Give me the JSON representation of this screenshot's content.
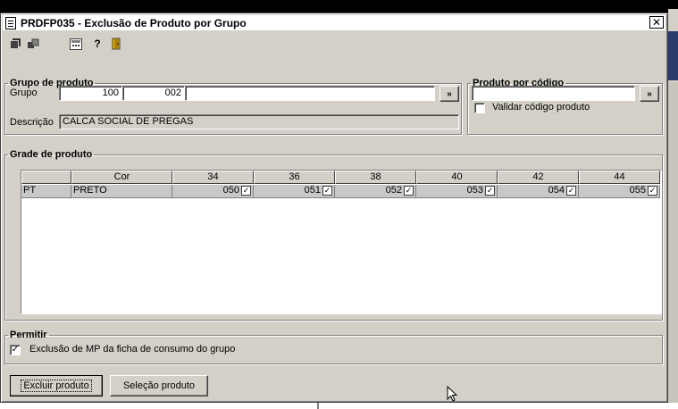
{
  "window": {
    "title": "PRDFP035 - Exclusão de Produto por Grupo",
    "close_symbol": "✕"
  },
  "toolbar": {
    "icons": [
      "arrow-icon",
      "copy-icon",
      "calculator-icon",
      "help-icon",
      "exit-door-icon"
    ],
    "help_symbol": "?"
  },
  "grupo": {
    "legend": "Grupo de produto",
    "grupo_label": "Grupo",
    "grupo_value1": "100",
    "grupo_value2": "002",
    "grupo_value3": "",
    "lookup_label": "»",
    "descricao_label": "Descrição",
    "descricao_value": "CALCA SOCIAL DE PREGAS"
  },
  "produto": {
    "legend": "Produto por código",
    "codigo_value": "",
    "lookup_label": "»",
    "validar_label": "Validar código produto",
    "validar_checked": ""
  },
  "grade": {
    "legend": "Grade de produto",
    "columns": [
      "",
      "Cor",
      "34",
      "36",
      "38",
      "40",
      "42",
      "44"
    ],
    "rows": [
      {
        "code": "PT",
        "color": "PRETO",
        "cells": [
          {
            "value": "050",
            "check": "✓"
          },
          {
            "value": "051",
            "check": "✓"
          },
          {
            "value": "052",
            "check": "✓"
          },
          {
            "value": "053",
            "check": "✓"
          },
          {
            "value": "054",
            "check": "✓"
          },
          {
            "value": "055",
            "check": "✓"
          }
        ]
      }
    ]
  },
  "permitir": {
    "legend": "Permitir",
    "exclusao_label": "Exclusão de MP da ficha de consumo do grupo",
    "exclusao_check": "✓"
  },
  "actions": {
    "excluir_label": "Excluir produto",
    "selecao_label": "Seleção produto"
  }
}
